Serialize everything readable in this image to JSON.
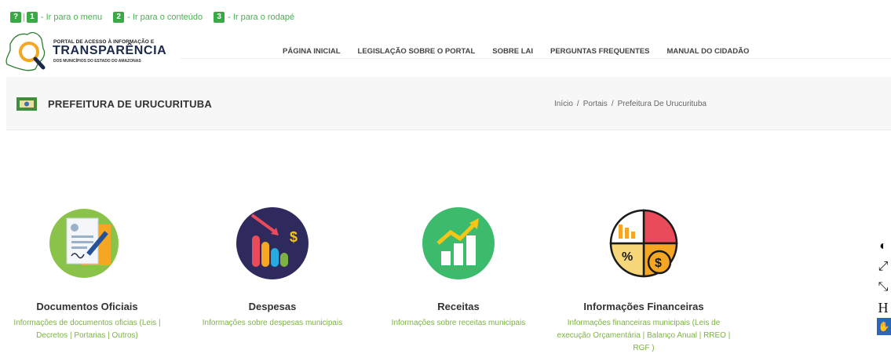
{
  "skip_links": [
    {
      "key": "1",
      "label": "- Ir para o menu"
    },
    {
      "key": "2",
      "label": "- Ir para o conteúdo"
    },
    {
      "key": "3",
      "label": "- Ir para o rodapé"
    }
  ],
  "help_key": "?",
  "logo": {
    "line1": "PORTAL DE ACESSO À INFORMAÇÃO E",
    "line2": "TRANSPARÊNCIA",
    "line3": "DOS MUNICÍPIOS DO ESTADO DO AMAZONAS"
  },
  "nav": [
    "PÁGINA INICIAL",
    "LEGISLAÇÃO SOBRE O PORTAL",
    "SOBRE LAI",
    "PERGUNTAS FREQUENTES",
    "MANUAL DO CIDADÃO"
  ],
  "page_title": "PREFEITURA DE URUCURITUBA",
  "breadcrumb": [
    "Início",
    "Portais",
    "Prefeitura De Urucurituba"
  ],
  "breadcrumb_sep": "/",
  "cards": [
    {
      "title": "Documentos Oficiais",
      "desc": "Informações de documentos oficias (Leis | Decretos | Portarias | Outros)"
    },
    {
      "title": "Despesas",
      "desc": "Informações sobre despesas municipais"
    },
    {
      "title": "Receitas",
      "desc": "Informações sobre receitas municipais"
    },
    {
      "title": "Informações Financeiras",
      "desc": "Informações financeiras municipais (Leis de execução Orçamentária | Balanço Anual | RREO | RGF )"
    }
  ],
  "a11y": {
    "contrast": "◐",
    "enlarge": "⤢",
    "shrink": "⤡",
    "font": "H",
    "libras": "✋"
  },
  "colors": {
    "accent": "#3aa845",
    "link_green": "#7cb342",
    "band_bg": "#f7f7f7"
  }
}
